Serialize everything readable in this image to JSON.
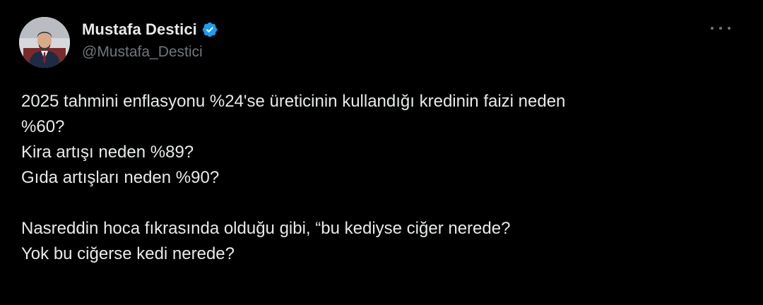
{
  "author": {
    "display_name": "Mustafa Destici",
    "handle": "@Mustafa_Destici",
    "verified": true,
    "avatar_icon": "user-avatar",
    "verified_icon": "verified-badge-icon"
  },
  "tweet": {
    "lines": [
      "2025 tahmini enflasyonu %24'se üreticinin kullandığı kredinin faizi neden",
      "%60?",
      "Kira artışı neden %89?",
      "Gıda artışları neden %90?",
      "",
      "Nasreddin hoca fıkrasında olduğu gibi, “bu kediyse ciğer nerede?",
      "Yok bu ciğerse kedi nerede?"
    ]
  },
  "more_icon": "more-options-icon",
  "colors": {
    "background": "#000000",
    "text": "#e7e9ea",
    "secondary": "#71767b",
    "verified": "#1d9bf0"
  }
}
